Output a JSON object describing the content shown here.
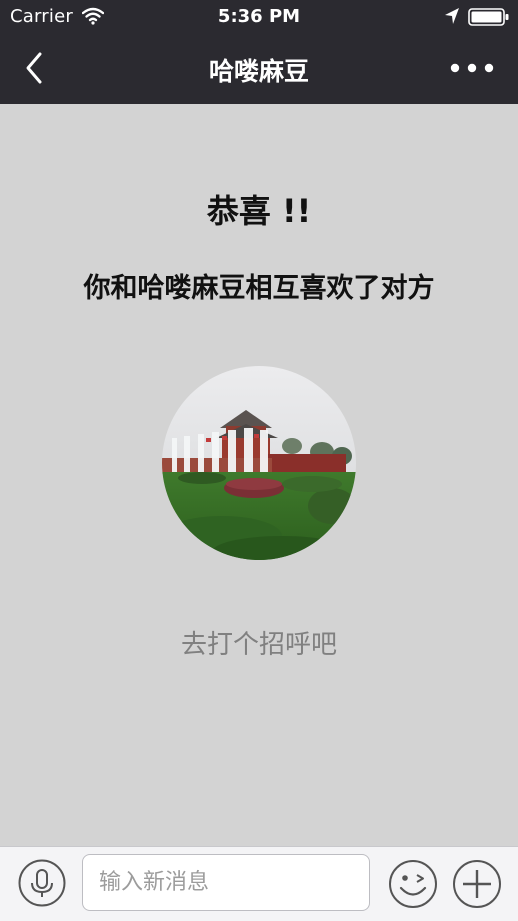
{
  "status_bar": {
    "carrier": "Carrier",
    "time": "5:36 PM",
    "icons": [
      "wifi-icon",
      "location-arrow-icon",
      "battery-icon"
    ]
  },
  "nav": {
    "title": "哈喽麻豆",
    "back_icon": "chevron-left-icon",
    "more_icon": "more-dots-icon"
  },
  "main": {
    "headline": "恭喜 !!",
    "message": "你和哈喽麻豆相互喜欢了对方",
    "greet_action": "去打个招呼吧"
  },
  "input_bar": {
    "placeholder": "输入新消息",
    "value": "",
    "icons": [
      "microphone-icon",
      "emoji-icon",
      "plus-icon"
    ]
  },
  "colors": {
    "nav_background": "#2b2a30",
    "page_background": "#d3d3d3",
    "input_bar_background": "#f4f4f6",
    "greet_text": "#808080"
  }
}
